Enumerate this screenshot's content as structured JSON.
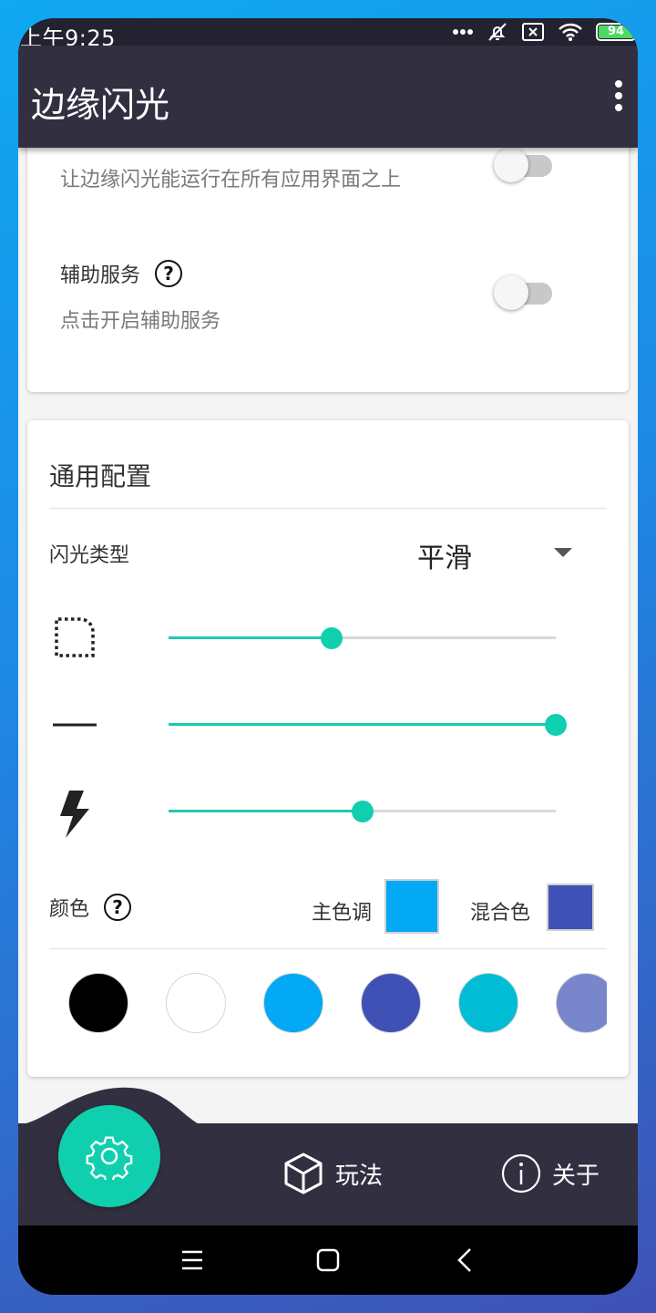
{
  "status": {
    "time": "上午9:25",
    "battery": "94",
    "battery_level": 0.94
  },
  "appbar": {
    "title": "边缘闪光",
    "more_icon": "more-vert-icon"
  },
  "permissions": {
    "overlay_subtitle": "让边缘闪光能运行在所有应用界面之上",
    "overlay_enabled": false,
    "accessibility_title": "辅助服务",
    "accessibility_subtitle": "点击开启辅助服务",
    "accessibility_enabled": false
  },
  "general": {
    "title": "通用配置",
    "flash_type_label": "闪光类型",
    "flash_type_value": "平滑",
    "sliders": [
      {
        "icon": "corner-radius-icon",
        "value": 0.42
      },
      {
        "icon": "line-width-icon",
        "value": 1.0
      },
      {
        "icon": "flash-speed-icon",
        "value": 0.5
      }
    ],
    "color_label": "颜色",
    "main_tone_label": "主色调",
    "main_tone_color": "#03a9f4",
    "mix_label": "混合色",
    "mix_color": "#3f51b5",
    "palette": [
      "#000000",
      "#ffffff",
      "#03a9f4",
      "#3f51b5",
      "#00bcd4",
      "#7986cb"
    ]
  },
  "bottom_nav": {
    "settings_icon": "gear-icon",
    "play_label": "玩法",
    "about_label": "关于"
  },
  "colors": {
    "accent": "#10cfae",
    "appbar": "#323040"
  }
}
